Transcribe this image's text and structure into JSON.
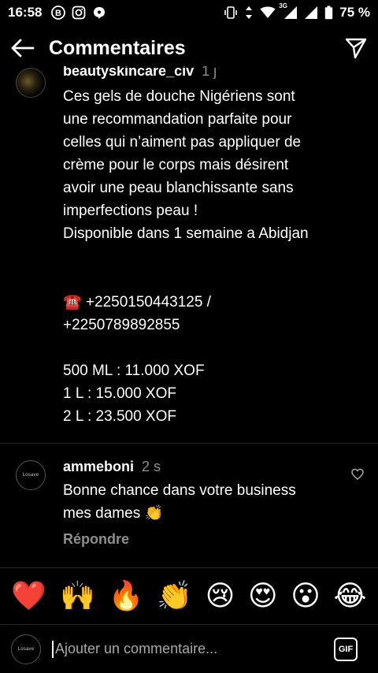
{
  "status": {
    "time": "16:58",
    "signal_label": "3G",
    "battery": "75 %"
  },
  "header": {
    "title": "Commentaires"
  },
  "comments": [
    {
      "username": "beautyskincare_civ",
      "time": "1 j",
      "text": "Ces gels de douche Nigériens sont\nune recommandation parfaite pour\ncelles qui n’aiment pas appliquer de\ncrème pour le corps mais désirent\navoir une peau blanchissante sans\nimperfections peau !\nDisponible dans 1 semaine a Abidjan\n\n\n☎️ +2250150443125 /\n+2250789892855\n\n500 ML : 11.000 XOF\n1 L : 15.000 XOF\n2 L : 23.500 XOF"
    },
    {
      "username": "ammeboni",
      "time": "2 s",
      "avatar_text": "Losave",
      "text": "Bonne chance dans votre business\nmes dames 👏",
      "reply_label": "Répondre"
    }
  ],
  "emoji_bar": [
    "❤️",
    "🙌",
    "🔥",
    "👏",
    "😢",
    "😍",
    "😮",
    "😂"
  ],
  "composer": {
    "avatar_text": "Losave",
    "placeholder": "Ajouter un commentaire...",
    "gif_label": "GIF"
  }
}
